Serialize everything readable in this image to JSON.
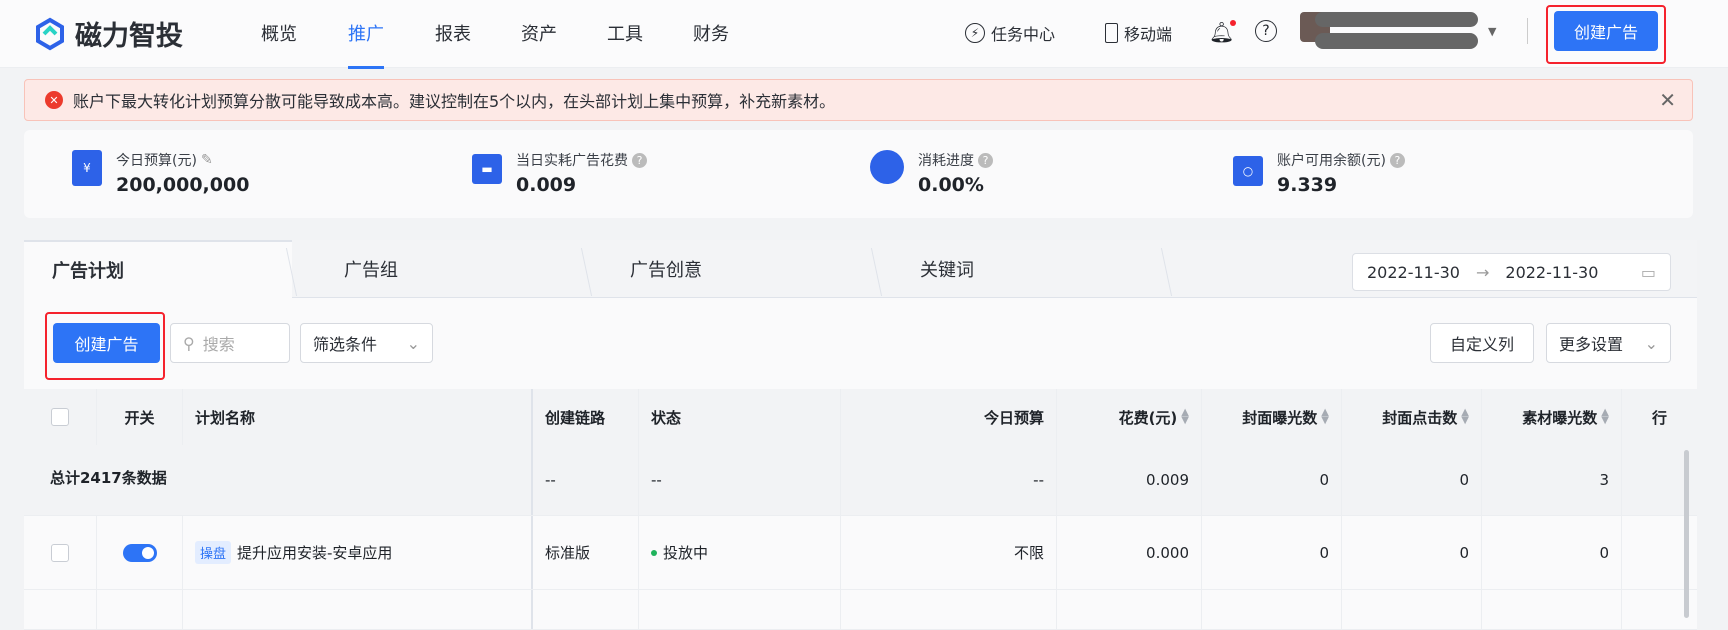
{
  "brand": {
    "name": "磁力智投"
  },
  "nav": [
    "概览",
    "推广",
    "报表",
    "资产",
    "工具",
    "财务"
  ],
  "header": {
    "task_center": "任务中心",
    "mobile": "移动端",
    "create_ad": "创建广告"
  },
  "alert": {
    "message": "账户下最大转化计划预算分散可能导致成本高。建议控制在5个以内，在头部计划上集中预算，补充新素材。"
  },
  "stats": [
    {
      "label": "今日预算(元)",
      "value": "200,000,000",
      "icon_text": "¥"
    },
    {
      "label": "当日实耗广告花费",
      "value": "0.009"
    },
    {
      "label": "消耗进度",
      "value": "0.00%"
    },
    {
      "label": "账户可用余额(元)",
      "value": "9.339"
    }
  ],
  "tabs": [
    "广告计划",
    "广告组",
    "广告创意",
    "关键词"
  ],
  "date_range": {
    "start": "2022-11-30",
    "end": "2022-11-30"
  },
  "toolbar": {
    "create_ad": "创建广告",
    "search_placeholder": "搜索",
    "filter": "筛选条件",
    "custom_columns": "自定义列",
    "more_settings": "更多设置"
  },
  "table": {
    "columns": [
      "开关",
      "计划名称",
      "创建链路",
      "状态",
      "今日预算",
      "花费(元)",
      "封面曝光数",
      "封面点击数",
      "素材曝光数",
      "行"
    ],
    "summary": {
      "label": "总计2417条数据",
      "chain": "--",
      "status": "--",
      "budget": "--",
      "cost": "0.009",
      "cover_imp": "0",
      "cover_click": "0",
      "material_imp": "3"
    },
    "rows": [
      {
        "tag": "操盘",
        "name": "提升应用安装-安卓应用",
        "chain": "标准版",
        "status": "投放中",
        "budget": "不限",
        "cost": "0.000",
        "cover_imp": "0",
        "cover_click": "0",
        "material_imp": "0"
      }
    ]
  },
  "colors": {
    "accent": "#2d74f6",
    "error": "#ec3b2d",
    "active_status": "#1fb35c"
  }
}
